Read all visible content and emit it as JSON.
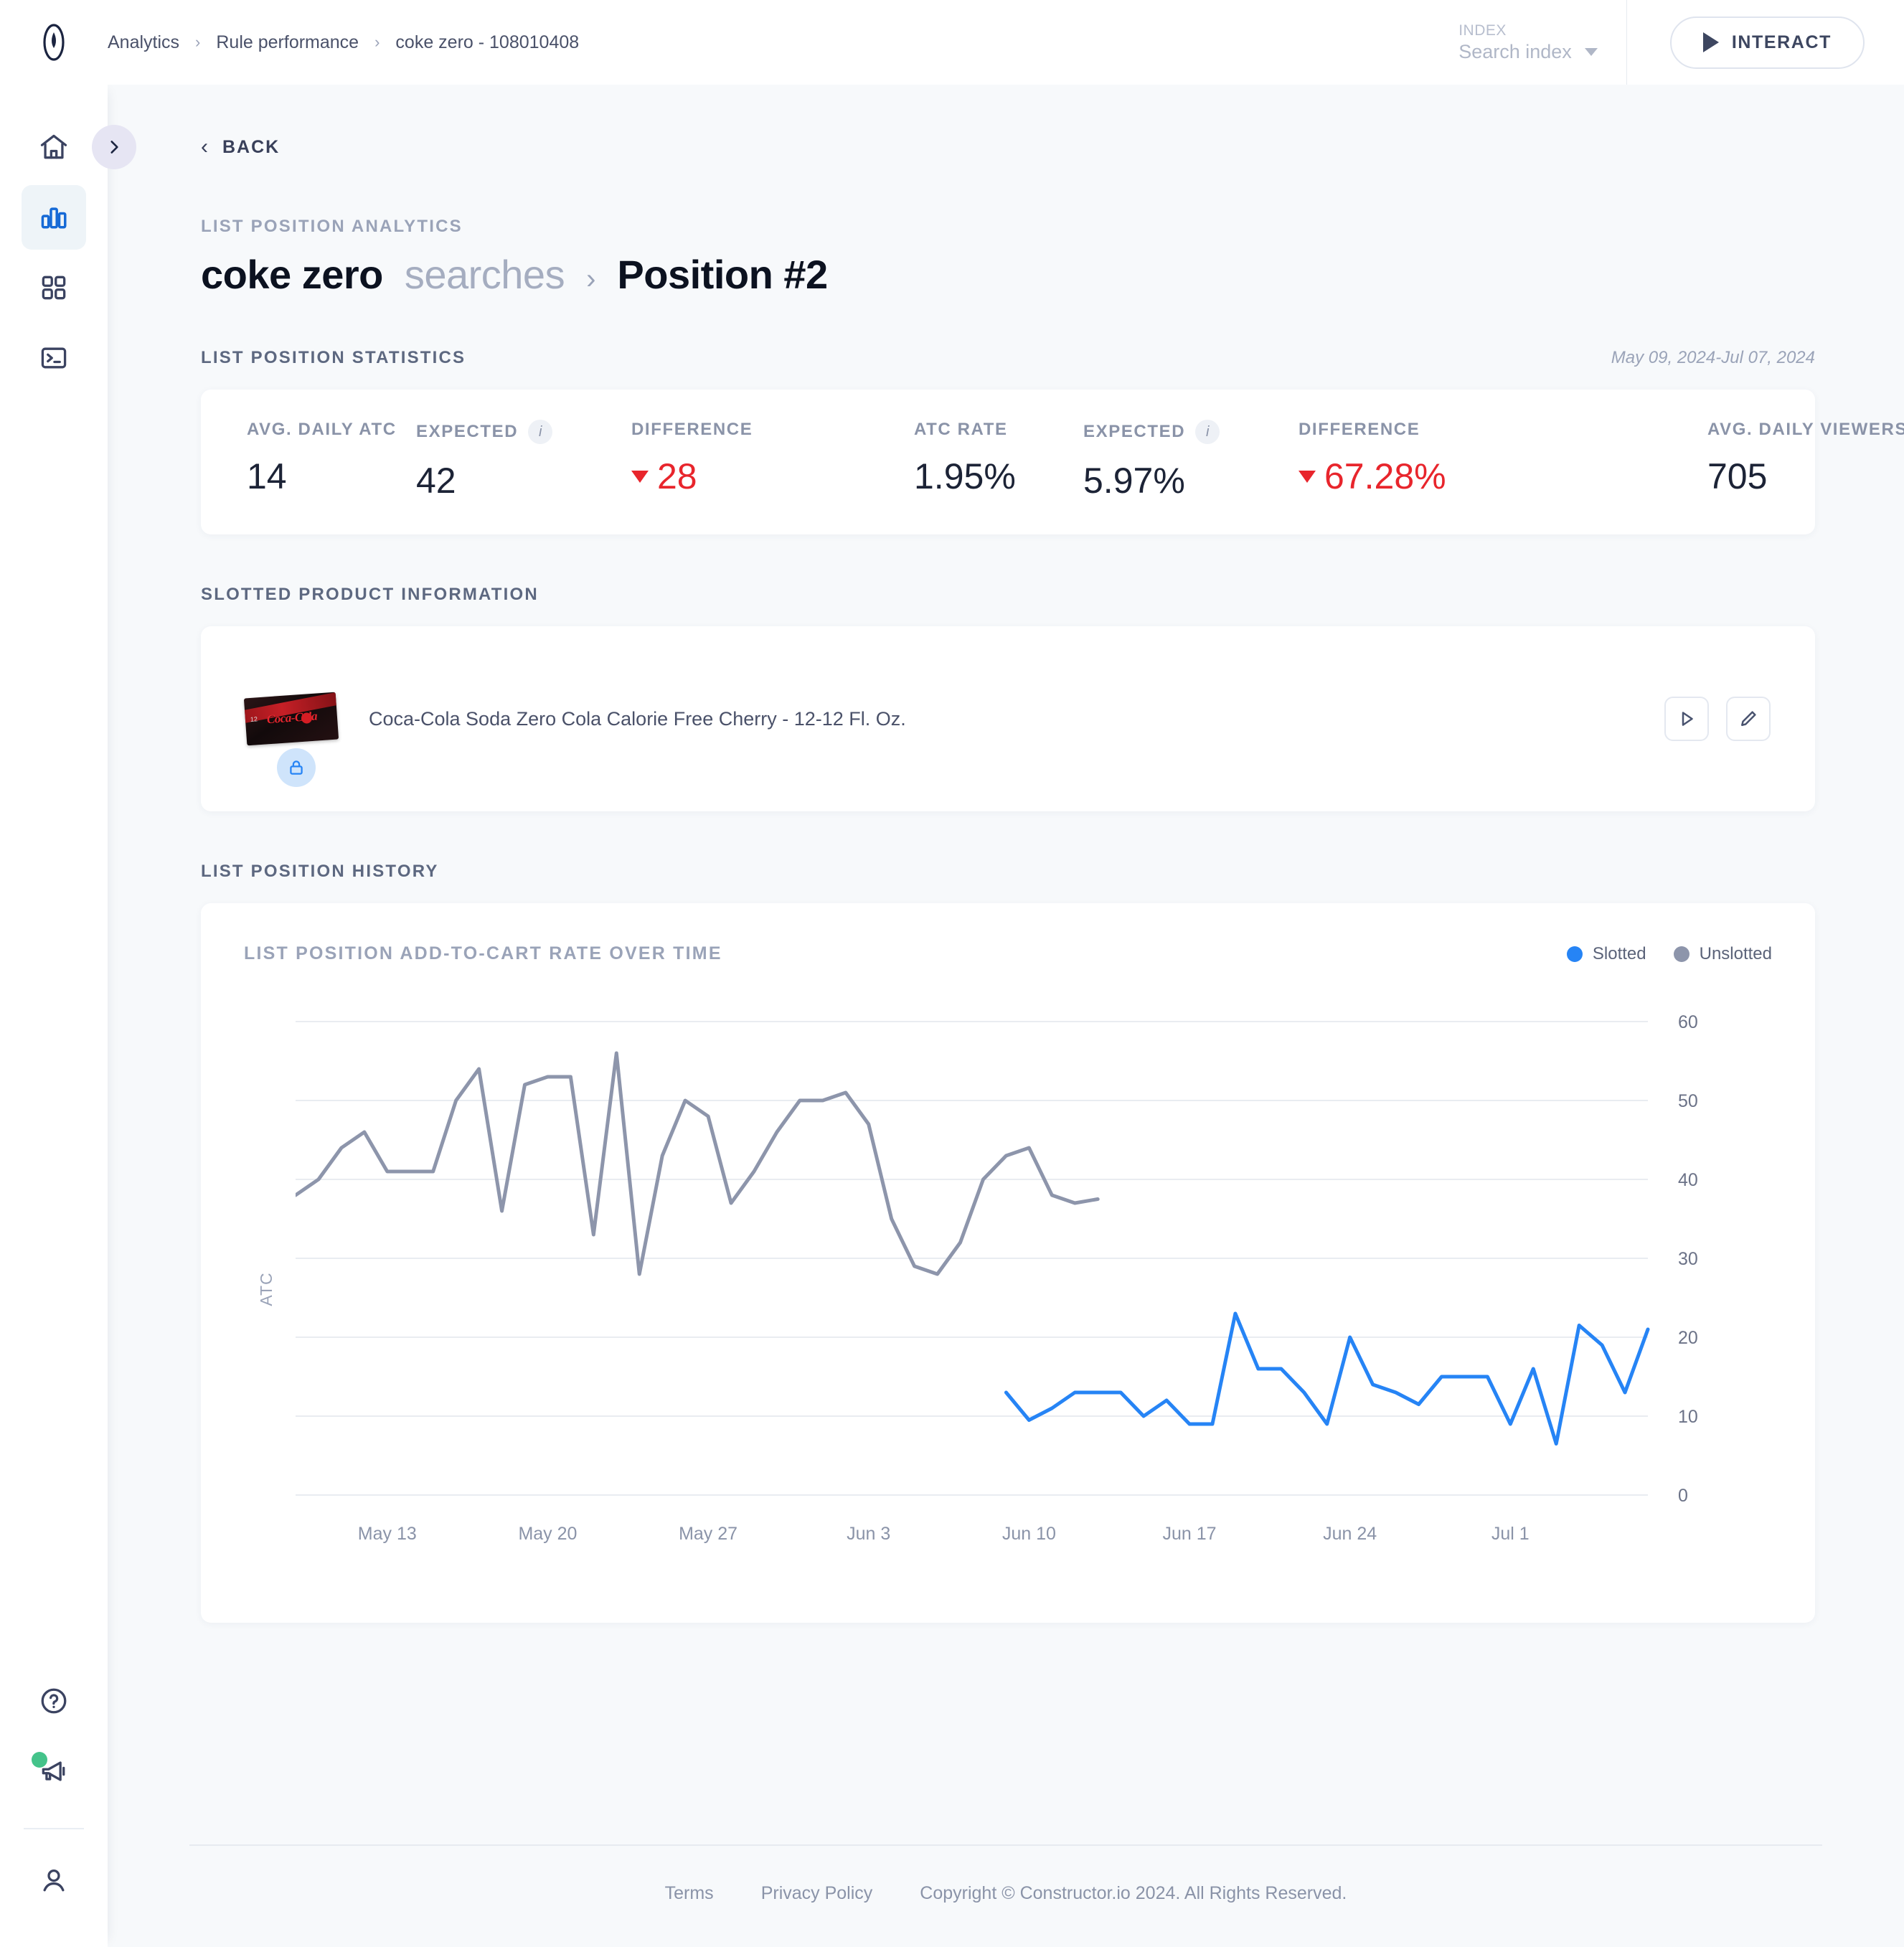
{
  "topbar": {
    "breadcrumb": [
      "Analytics",
      "Rule performance",
      "coke zero - 108010408"
    ],
    "separator": "›",
    "index_label": "INDEX",
    "index_value": "Search index",
    "interact_label": "INTERACT"
  },
  "sidebar": {
    "items": [
      {
        "name": "home-icon",
        "active": false
      },
      {
        "name": "analytics-icon",
        "active": true
      },
      {
        "name": "grid-icon",
        "active": false
      },
      {
        "name": "terminal-icon",
        "active": false
      },
      {
        "name": "help-icon",
        "active": false
      },
      {
        "name": "announcements-icon",
        "active": false
      },
      {
        "name": "account-icon",
        "active": false
      }
    ]
  },
  "page": {
    "back_label": "BACK",
    "eyebrow": "LIST POSITION ANALYTICS",
    "title_strong": "coke zero",
    "title_muted": "searches",
    "title_separator": "›",
    "title_position": "Position #2"
  },
  "stats_section": {
    "title": "LIST POSITION STATISTICS",
    "date_range": "May 09, 2024-Jul 07, 2024",
    "groups": [
      {
        "metrics": [
          {
            "label": "AVG. DAILY ATC",
            "value": "14",
            "info": false,
            "negative": false
          },
          {
            "label": "EXPECTED",
            "value": "42",
            "info": true,
            "negative": false
          },
          {
            "label": "DIFFERENCE",
            "value": "28",
            "info": false,
            "negative": true
          }
        ]
      },
      {
        "metrics": [
          {
            "label": "ATC RATE",
            "value": "1.95%",
            "info": false,
            "negative": false
          },
          {
            "label": "EXPECTED",
            "value": "5.97%",
            "info": true,
            "negative": false
          },
          {
            "label": "DIFFERENCE",
            "value": "67.28%",
            "info": false,
            "negative": true
          }
        ]
      },
      {
        "metrics": [
          {
            "label": "AVG. DAILY VIEWERS",
            "value": "705",
            "info": false,
            "negative": false
          }
        ]
      }
    ]
  },
  "product_section": {
    "title": "SLOTTED PRODUCT INFORMATION",
    "product_name": "Coca-Cola Soda Zero Cola Calorie Free Cherry - 12-12 Fl. Oz.",
    "badge": "lock-icon",
    "actions": [
      "play-icon",
      "edit-icon"
    ]
  },
  "history_section": {
    "title": "LIST POSITION HISTORY"
  },
  "footer": {
    "terms": "Terms",
    "privacy": "Privacy Policy",
    "copyright": "Copyright © Constructor.io 2024. All Rights Reserved."
  },
  "colors": {
    "slotted": "#2684f5",
    "unslotted": "#8d95ab",
    "negative": "#e8252c",
    "accent": "#1569d6"
  },
  "chart_data": {
    "type": "line",
    "title": "LIST POSITION ADD-TO-CART RATE OVER TIME",
    "xlabel": "",
    "ylabel": "ATC",
    "ylim": [
      0,
      60
    ],
    "yticks": [
      0,
      10,
      20,
      30,
      40,
      50,
      60
    ],
    "grid": true,
    "legend_position": "top-right",
    "x_tick_labels": [
      "May 13",
      "May 20",
      "May 27",
      "Jun 3",
      "Jun 10",
      "Jun 17",
      "Jun 24",
      "Jul 1"
    ],
    "x_tick_indices": [
      4,
      11,
      18,
      25,
      32,
      39,
      46,
      53
    ],
    "x_domain": [
      "May 09, 2024",
      "Jul 07, 2024"
    ],
    "n_points": 60,
    "series": [
      {
        "name": "Unslotted",
        "color": "#8d95ab",
        "start_index": 0,
        "values": [
          38,
          40,
          44,
          46,
          41,
          41,
          41,
          50,
          54,
          36,
          52,
          53,
          53,
          33,
          56,
          28,
          43,
          50,
          48,
          37,
          41,
          46,
          50,
          50,
          51,
          47,
          35,
          29,
          28,
          32,
          40,
          43,
          44,
          38,
          37,
          37.5,
          null,
          null,
          null,
          null,
          null,
          null,
          null,
          null,
          null,
          null,
          null,
          null,
          null,
          null,
          null,
          null,
          null,
          null,
          null,
          null,
          null,
          null,
          null,
          null
        ]
      },
      {
        "name": "Slotted",
        "color": "#2684f5",
        "start_index": 31,
        "values": [
          null,
          null,
          null,
          null,
          null,
          null,
          null,
          null,
          null,
          null,
          null,
          null,
          null,
          null,
          null,
          null,
          null,
          null,
          null,
          null,
          null,
          null,
          null,
          null,
          null,
          null,
          null,
          null,
          null,
          null,
          null,
          13,
          9.5,
          11,
          13,
          13,
          13,
          10,
          12,
          9,
          9,
          23,
          16,
          16,
          13,
          9,
          20,
          14,
          13,
          11.5,
          15,
          15,
          15,
          9,
          16,
          6.5,
          21.5,
          19,
          13,
          21
        ]
      }
    ]
  }
}
